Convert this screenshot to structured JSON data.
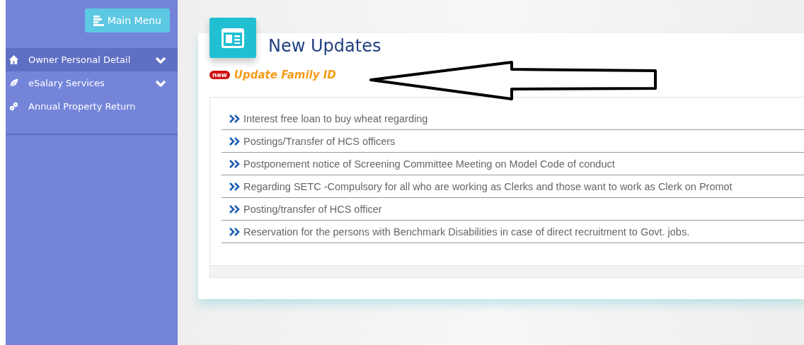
{
  "sidebar": {
    "menu_button": "Main Menu",
    "items": [
      {
        "label": "Owner Personal Detail",
        "kind": "home",
        "expandable": true,
        "selected": true
      },
      {
        "label": "eSalary Services",
        "kind": "leaf",
        "expandable": true,
        "selected": false
      },
      {
        "label": "Annual Property Return",
        "kind": "link",
        "expandable": false,
        "selected": false
      }
    ]
  },
  "panel": {
    "title": "New Updates",
    "new_badge": "new",
    "highlight_link": "Update Family ID",
    "updates": [
      "Interest free loan to buy wheat regarding",
      "Postings/Transfer of HCS officers",
      "Postponement notice of Screening Committee Meeting on Model Code of conduct",
      "Regarding SETC -Compulsory for all who are working as Clerks and those want to work as Clerk on Promot",
      "Posting/transfer of HCS officer",
      "Reservation for the persons with Benchmark Disabilities in case of direct recruitment to Govt. jobs."
    ]
  }
}
